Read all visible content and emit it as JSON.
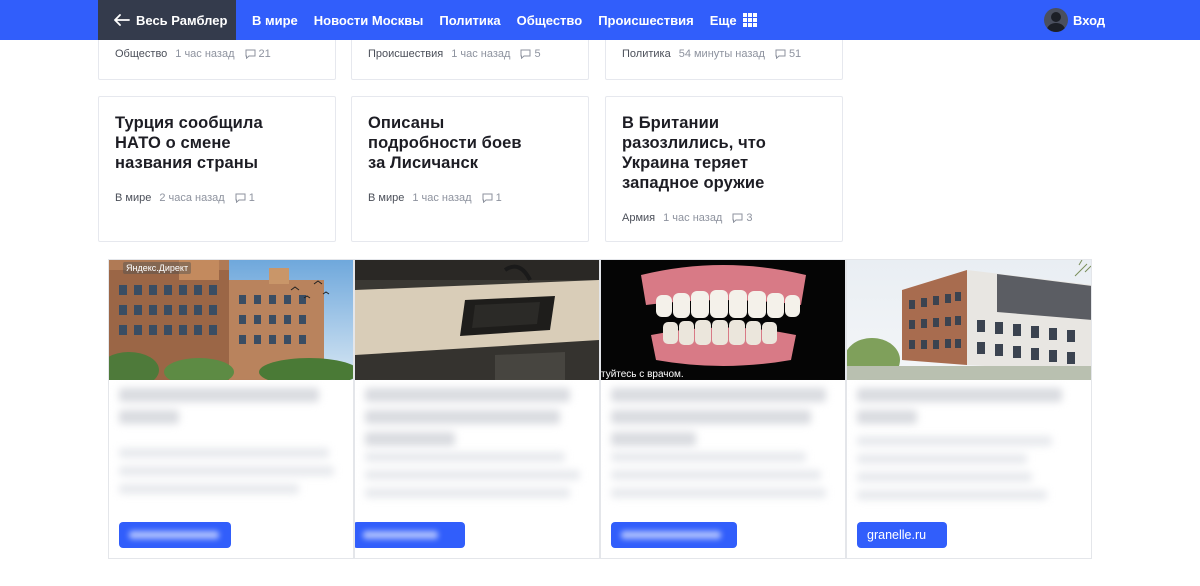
{
  "header": {
    "back_label": "Весь Рамблер",
    "nav": [
      "В мире",
      "Новости Москвы",
      "Политика",
      "Общество",
      "Происшествия"
    ],
    "more_label": "Еще",
    "login_label": "Вход"
  },
  "top_cards": [
    {
      "category": "Общество",
      "time": "1 час назад",
      "comments": "21"
    },
    {
      "category": "Происшествия",
      "time": "1 час назад",
      "comments": "5"
    },
    {
      "category": "Политика",
      "time": "54 минуты назад",
      "comments": "51"
    }
  ],
  "cards": [
    {
      "title": "Турция сообщила НАТО о смене названия страны",
      "category": "В мире",
      "time": "2 часа назад",
      "comments": "1"
    },
    {
      "title": "Описаны подробности боев за Лисичанск",
      "category": "В мире",
      "time": "1 час назад",
      "comments": "1"
    },
    {
      "title": "В Британии разозлились, что Украина теряет западное оружие",
      "category": "Армия",
      "time": "1 час назад",
      "comments": "3"
    }
  ],
  "ads": {
    "label": "Яндекс.Директ",
    "caption_3": "туйтесь с врачом.",
    "button_4": "granelle.ru"
  },
  "colors": {
    "accent": "#315efb",
    "back_bg": "#343b4c"
  }
}
